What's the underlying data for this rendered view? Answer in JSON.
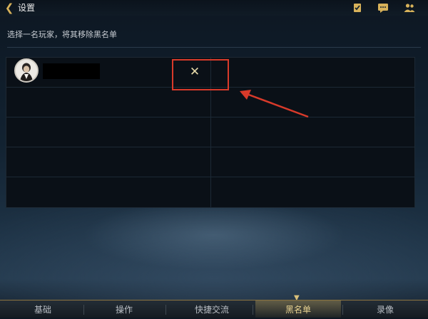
{
  "header": {
    "title": "设置",
    "icons": [
      "checklist-icon",
      "chat-icon",
      "friends-icon"
    ]
  },
  "instruction": "选择一名玩家，将其移除黑名单",
  "blacklist": {
    "rows": [
      {
        "avatar": "player-avatar",
        "name_redacted": true,
        "action": "✕"
      }
    ]
  },
  "annotation": {
    "color": "#d83a2a"
  },
  "tabs": [
    {
      "label": "基础",
      "active": false
    },
    {
      "label": "操作",
      "active": false
    },
    {
      "label": "快捷交流",
      "active": false
    },
    {
      "label": "黑名单",
      "active": true
    },
    {
      "label": "录像",
      "active": false
    }
  ],
  "colors": {
    "accent": "#d8b25a",
    "active_tab": "#e9d391",
    "annotation": "#d83a2a"
  }
}
